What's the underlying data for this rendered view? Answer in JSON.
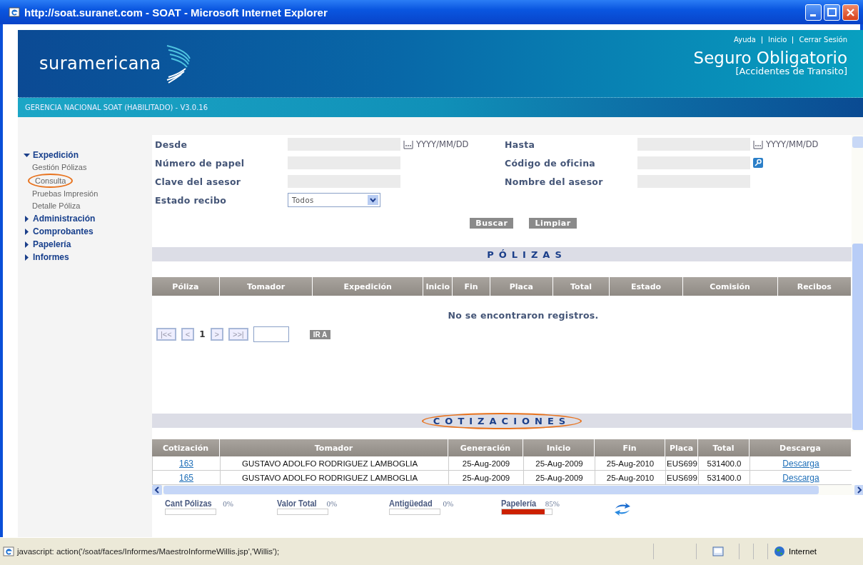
{
  "window": {
    "title": "http://soat.suranet.com - SOAT - Microsoft Internet Explorer"
  },
  "header": {
    "brand": "suramericana",
    "links": [
      "Ayuda",
      "Inicio",
      "Cerrar Sesión"
    ],
    "title": "Seguro Obligatorio",
    "subtitle": "[Accidentes de Transito]",
    "subbar": "GERENCIA NACIONAL SOAT (HABILITADO) - V3.0.16"
  },
  "sidebar": {
    "items": [
      {
        "label": "Expedición",
        "expanded": true,
        "children": [
          {
            "label": "Gestión Pólizas",
            "annotated": false
          },
          {
            "label": "Consulta",
            "annotated": true
          },
          {
            "label": "Pruebas Impresión",
            "annotated": false
          },
          {
            "label": "Detalle Póliza",
            "annotated": false
          }
        ]
      },
      {
        "label": "Administración",
        "expanded": false
      },
      {
        "label": "Comprobantes",
        "expanded": false
      },
      {
        "label": "Papelería",
        "expanded": false
      },
      {
        "label": "Informes",
        "expanded": false
      }
    ]
  },
  "form": {
    "rows": [
      [
        {
          "label": "Desde",
          "kind": "date",
          "format": "YYYY/MM/DD"
        },
        {
          "label": "Hasta",
          "kind": "date",
          "format": "YYYY/MM/DD"
        }
      ],
      [
        {
          "label": "Número de papel",
          "kind": "text"
        },
        {
          "label": "Código de oficina",
          "kind": "lookup"
        }
      ],
      [
        {
          "label": "Clave del asesor",
          "kind": "text"
        },
        {
          "label": "Nombre del asesor",
          "kind": "text"
        }
      ],
      [
        {
          "label": "Estado recibo",
          "kind": "select",
          "value": "Todos"
        }
      ]
    ],
    "buttons": [
      "Buscar",
      "Limpiar"
    ]
  },
  "polizas": {
    "title": "PÓLIZAS",
    "annotated": false,
    "columns": [
      "Póliza",
      "Tomador",
      "Expedición",
      "Inicio",
      "Fin",
      "Placa",
      "Total",
      "Estado",
      "Comisión",
      "Recibos"
    ],
    "empty_message": "No se encontraron registros.",
    "pager": {
      "first": "|<<",
      "prev": "<",
      "page": "1",
      "next": ">",
      "last": ">>|",
      "go": "IR A"
    }
  },
  "cotizaciones": {
    "title": "COTIZACIONES",
    "annotated": true,
    "columns": [
      "Cotización",
      "Tomador",
      "Generación",
      "Inicio",
      "Fin",
      "Placa",
      "Total",
      "Descarga"
    ],
    "rows": [
      [
        "163",
        "GUSTAVO ADOLFO RODRIGUEZ LAMBOGLIA",
        "25-Aug-2009",
        "25-Aug-2009",
        "25-Aug-2010",
        "EUS699",
        "531400.0",
        "Descarga"
      ],
      [
        "165",
        "GUSTAVO ADOLFO RODRIGUEZ LAMBOGLIA",
        "25-Aug-2009",
        "25-Aug-2009",
        "25-Aug-2010",
        "EUS699",
        "531400.0",
        "Descarga"
      ]
    ]
  },
  "meters": [
    {
      "label": "Cant Pólizas",
      "reading": "0%",
      "level": 0
    },
    {
      "label": "Valor Total",
      "reading": "0%",
      "level": 0
    },
    {
      "label": "Antigüedad",
      "reading": "0%",
      "level": 0
    },
    {
      "label": "Papelería",
      "reading": "85%",
      "level": 0.85
    }
  ],
  "status_bar": {
    "text": "javascript: action('/soat/faces/Informes/MaestroInformeWillis.jsp','Willis');",
    "zone": "Internet"
  }
}
